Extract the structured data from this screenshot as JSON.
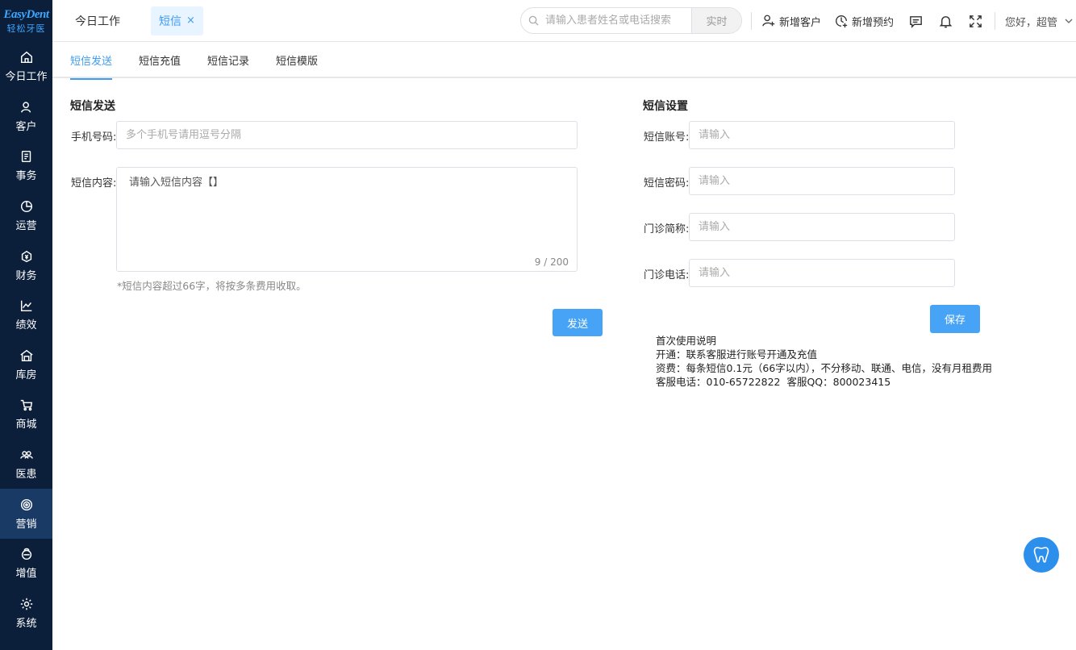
{
  "brand": {
    "logo_main": "EasyDent",
    "logo_sub": "轻松牙医"
  },
  "sidebar": {
    "items": [
      {
        "label": "今日工作",
        "icon": "home-icon"
      },
      {
        "label": "客户",
        "icon": "user-icon"
      },
      {
        "label": "事务",
        "icon": "task-icon"
      },
      {
        "label": "运营",
        "icon": "pie-icon"
      },
      {
        "label": "财务",
        "icon": "finance-icon"
      },
      {
        "label": "绩效",
        "icon": "chart-icon"
      },
      {
        "label": "库房",
        "icon": "warehouse-icon"
      },
      {
        "label": "商城",
        "icon": "cart-icon"
      },
      {
        "label": "医患",
        "icon": "people-icon"
      },
      {
        "label": "营销",
        "icon": "target-icon"
      },
      {
        "label": "增值",
        "icon": "gift-icon"
      },
      {
        "label": "系统",
        "icon": "gear-icon"
      }
    ],
    "active_index": 9
  },
  "tabs": {
    "home": "今日工作",
    "current": "短信",
    "close": "×"
  },
  "search": {
    "placeholder": "请输入患者姓名或电话搜索",
    "mode": "实时"
  },
  "top_actions": {
    "add_customer": "新增客户",
    "add_appointment": "新增预约",
    "greeting": "您好，超管"
  },
  "subtabs": [
    "短信发送",
    "短信充值",
    "短信记录",
    "短信模版"
  ],
  "send": {
    "title": "短信发送",
    "phone_label": "手机号码:",
    "phone_placeholder": "多个手机号请用逗号分隔",
    "content_label": "短信内容:",
    "content_placeholder": "请输入短信内容【】",
    "counter": "9 / 200",
    "hint": "*短信内容超过66字，将按多条费用收取。",
    "send_button": "发送"
  },
  "settings": {
    "title": "短信设置",
    "fields": [
      {
        "label": "短信账号:",
        "placeholder": "请输入"
      },
      {
        "label": "短信密码:",
        "placeholder": "请输入"
      },
      {
        "label": "门诊简称:",
        "placeholder": "请输入"
      },
      {
        "label": "门诊电话:",
        "placeholder": "请输入"
      }
    ],
    "save_button": "保存"
  },
  "instructions": {
    "title": "首次使用说明",
    "line1": "开通：联系客服进行账号开通及充值",
    "line2": "资费：每条短信0.1元（66字以内），不分移动、联通、电信，没有月租费用",
    "line3": "客服电话：010-65722822  客服QQ：800023415"
  },
  "colors": {
    "sidebar_bg": "#0b1f3a",
    "accent": "#3f9cf0",
    "button": "#47a3f5"
  }
}
